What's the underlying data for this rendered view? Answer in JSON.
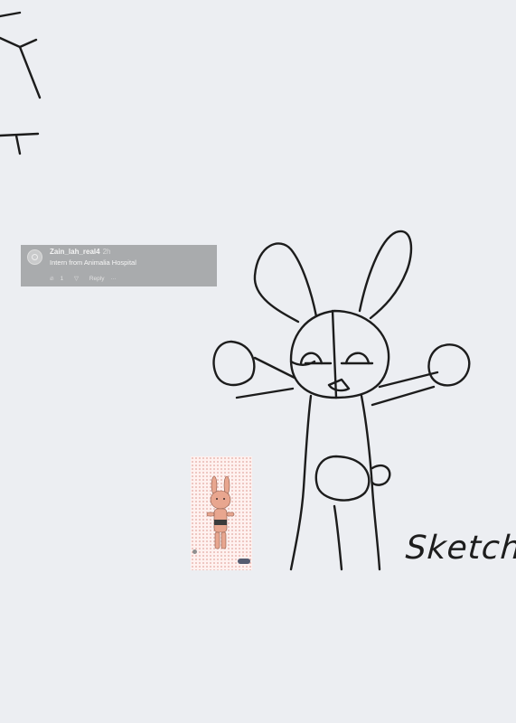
{
  "comment": {
    "username": "Zain_lah_real4",
    "time": "2h",
    "text": "Intern from Animalia Hospital",
    "likes": "1",
    "reply_label": "Reply",
    "more_label": "···"
  },
  "thumbnail": {
    "header_text": "",
    "footer_text": ""
  },
  "sketch_label": "Sketch",
  "icons": {
    "avatar": "avatar-icon",
    "like": "flame-icon",
    "dislike": "thumbs-down-icon"
  }
}
